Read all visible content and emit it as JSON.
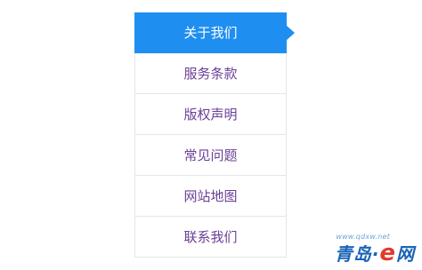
{
  "menu": {
    "items": [
      {
        "label": "关于我们",
        "active": true
      },
      {
        "label": "服务条款",
        "active": false
      },
      {
        "label": "版权声明",
        "active": false
      },
      {
        "label": "常见问题",
        "active": false
      },
      {
        "label": "网站地图",
        "active": false
      },
      {
        "label": "联系我们",
        "active": false
      }
    ]
  },
  "colors": {
    "active_bg": "#1e8ff0",
    "item_text": "#6a3f95",
    "border": "#e6e6e6"
  },
  "watermark": {
    "url": "www.qdxw.net",
    "brand_prefix": "青岛·",
    "brand_e": "e",
    "brand_suffix": "网"
  }
}
